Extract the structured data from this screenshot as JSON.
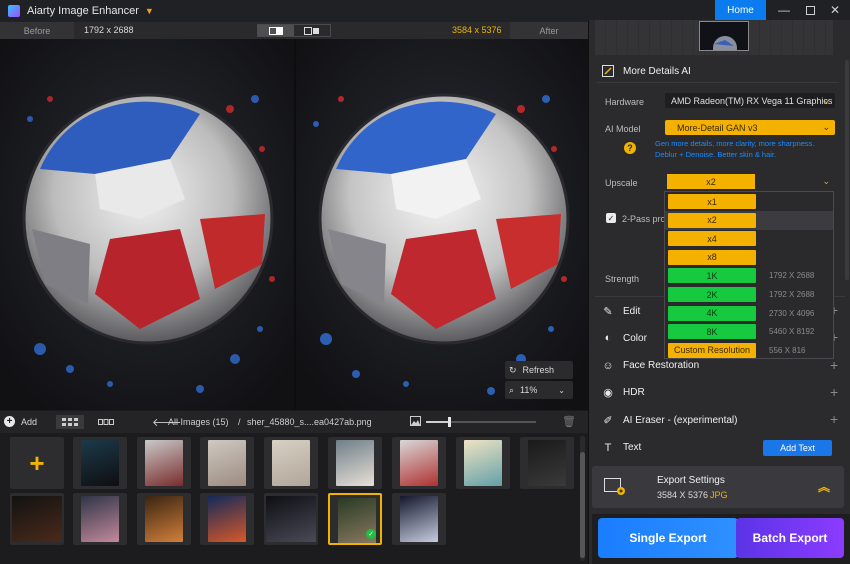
{
  "app": {
    "title": "Aiarty Image Enhancer",
    "home_label": "Home"
  },
  "window_controls": [
    "minimize-icon",
    "maximize-icon",
    "close-icon"
  ],
  "compare": {
    "before_label": "Before",
    "before_size": "1792 x 2688",
    "after_size": "3584 x 5376",
    "after_label": "After",
    "refresh_label": "Refresh",
    "zoom_value": "11%"
  },
  "gallery": {
    "add_label": "Add",
    "crumb_all": "All Images (15)",
    "crumb_sep": "/",
    "crumb_file": "sher_45880_s....ea0427ab.png",
    "zoom_slider_fraction": 0.22,
    "thumbnails": [
      {
        "color_a": "#1c3a4a",
        "color_b": "#0e0e10"
      },
      {
        "color_a": "#c9c9c9",
        "color_b": "#7a2c2c"
      },
      {
        "color_a": "#cfc9c2",
        "color_b": "#9c8b80"
      },
      {
        "color_a": "#d8d0c4",
        "color_b": "#b0a699"
      },
      {
        "color_a": "#6f7f88",
        "color_b": "#e8e0d8"
      },
      {
        "color_a": "#d8d8d8",
        "color_b": "#b03030"
      },
      {
        "color_a": "#efe3c3",
        "color_b": "#63a0a8"
      },
      {
        "color_a": "#1a1a1a",
        "color_b": "#3a3a3a"
      },
      {
        "color_a": "#121212",
        "color_b": "#4a2a1a"
      },
      {
        "color_a": "#303448",
        "color_b": "#c28a9a"
      },
      {
        "color_a": "#3a2412",
        "color_b": "#d2803a"
      },
      {
        "color_a": "#122a5a",
        "color_b": "#d8582a"
      },
      {
        "color_a": "#0e0e14",
        "color_b": "#4a4a56"
      },
      {
        "color_a": "#2a3a24",
        "color_b": "#8a7a60"
      },
      {
        "color_a": "#12182e",
        "color_b": "#c8cce0"
      },
      {
        "color_a": "#0e1428",
        "color_b": "#2a4a80"
      }
    ]
  },
  "panel": {
    "section_title": "More Details AI",
    "hardware_label": "Hardware",
    "hardware_value": "AMD Radeon(TM) RX Vega 11 Graphics",
    "ai_model_label": "AI Model",
    "ai_model_value": "More-Detail GAN  v3",
    "hint_line1": "Gen more details, more clarity, more sharpness.",
    "hint_line2": "Deblur + Denoise. Better skin & hair.",
    "upscale_label": "Upscale",
    "upscale_value": "x2",
    "two_pass_label": "2-Pass pro",
    "strength_label": "Strength",
    "sections": [
      "Edit",
      "Color",
      "Face Restoration",
      "HDR",
      "AI Eraser - (experimental)",
      "Text"
    ],
    "add_text_label": "Add Text"
  },
  "upscale_options": [
    {
      "label": "x1",
      "res": "",
      "color": "orange"
    },
    {
      "label": "x2",
      "res": "",
      "color": "orange"
    },
    {
      "label": "x4",
      "res": "",
      "color": "orange"
    },
    {
      "label": "x8",
      "res": "",
      "color": "orange"
    },
    {
      "label": "1K",
      "res": "1792 X 2688",
      "color": "green"
    },
    {
      "label": "2K",
      "res": "1792 X 2688",
      "color": "green"
    },
    {
      "label": "4K",
      "res": "2730 X 4096",
      "color": "green"
    },
    {
      "label": "8K",
      "res": "5460 X 8192",
      "color": "green"
    },
    {
      "label": "Custom Resolution",
      "res": "556 X 816",
      "color": "orange"
    }
  ],
  "export": {
    "title": "Export Settings",
    "size": "3584 X 5376",
    "format": "JPG",
    "single_label": "Single Export",
    "batch_label": "Batch Export"
  },
  "colors": {
    "accent_orange": "#f5b100",
    "accent_green": "#17c93f",
    "accent_blue": "#0a7cf0",
    "accent_purple": "#8b3bff"
  }
}
